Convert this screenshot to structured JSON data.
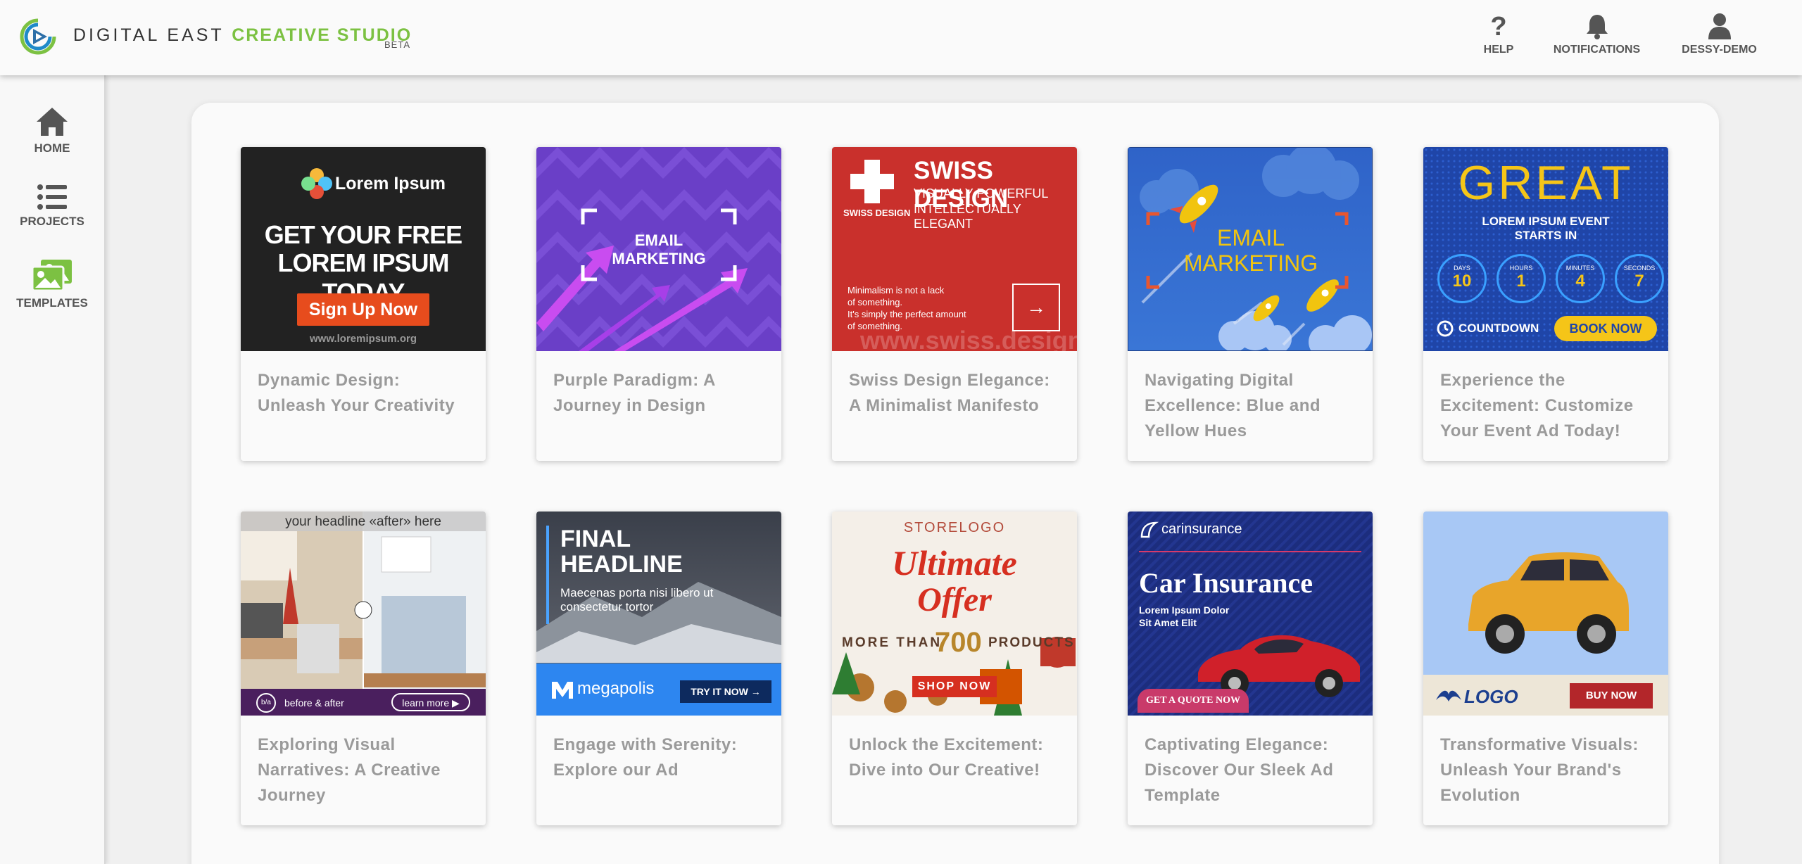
{
  "header": {
    "brand_part1": "DIGITAL EAST",
    "brand_part2": "CREATIVE STUDIO",
    "beta": "BETA",
    "help_label": "HELP",
    "notifications_label": "NOTIFICATIONS",
    "user_label": "DESSY-DEMO"
  },
  "sidebar": {
    "items": [
      {
        "label": "HOME",
        "icon": "home-icon"
      },
      {
        "label": "PROJECTS",
        "icon": "list-icon"
      },
      {
        "label": "TEMPLATES",
        "icon": "images-icon"
      }
    ]
  },
  "colors": {
    "brand_green": "#7cc142",
    "text_gray": "#9a9a9a"
  },
  "templates": [
    {
      "title": "Dynamic Design: Unleash Your Creativity",
      "thumb": {
        "brand": "Lorem Ipsum",
        "headline1": "GET YOUR FREE",
        "headline2": "LOREM IPSUM TODAY",
        "button": "Sign Up Now",
        "url": "www.loremipsum.org"
      }
    },
    {
      "title": "Purple Paradigm: A Journey in Design",
      "thumb": {
        "line1": "EMAIL",
        "line2": "MARKETING"
      }
    },
    {
      "title": "Swiss Design Elegance: A Minimalist Manifesto",
      "thumb": {
        "logo_caption": "SWISS DESIGN",
        "heading": "SWISS DESIGN",
        "sub1": "VISUALLY POWERFUL",
        "sub2": "INTELLECTUALLY ELEGANT",
        "body1": "Minimalism is not a lack",
        "body2": "of something.",
        "body3": "It's simply the perfect amount",
        "body4": "of something.",
        "watermark": "www.swiss.design"
      }
    },
    {
      "title": "Navigating Digital Excellence: Blue and Yellow Hues",
      "thumb": {
        "line1": "EMAIL",
        "line2": "MARKETING"
      }
    },
    {
      "title": "Experience the Excitement: Customize Your Event Ad Today!",
      "thumb": {
        "big": "GREAT",
        "sub1": "LOREM IPSUM EVENT",
        "sub2": "STARTS IN",
        "units": [
          {
            "label": "DAYS",
            "value": "10"
          },
          {
            "label": "HOURS",
            "value": "1"
          },
          {
            "label": "MINUTES",
            "value": "4"
          },
          {
            "label": "SECONDS",
            "value": "7"
          }
        ],
        "countdown": "COUNTDOWN",
        "button": "BOOK NOW"
      }
    },
    {
      "title": "Exploring Visual Narratives: A Creative Journey",
      "thumb": {
        "headline": "your headline «after» here",
        "caption": "before & after",
        "button": "learn more ▶"
      }
    },
    {
      "title": "Engage with Serenity: Explore our Ad",
      "thumb": {
        "h1": "FINAL",
        "h2": "HEADLINE",
        "body1": "Maecenas porta nisi libero ut",
        "body2": "consectetur tortor",
        "brand": "megapolis",
        "button": "TRY IT NOW →"
      }
    },
    {
      "title": "Unlock the Excitement: Dive into Our Creative!",
      "thumb": {
        "store": "STORELOGO",
        "h1": "Ultimate",
        "h2": "Offer",
        "more": "MORE THAN",
        "num": "700",
        "products": "PRODUCTS",
        "button": "SHOP NOW"
      }
    },
    {
      "title": "Captivating Elegance: Discover Our Sleek Ad Template",
      "thumb": {
        "brand": "carinsurance",
        "heading": "Car Insurance",
        "sub1": "Lorem Ipsum Dolor",
        "sub2": "Sit Amet Elit",
        "button": "GET A QUOTE NOW"
      }
    },
    {
      "title": "Transformative Visuals: Unleash Your Brand's Evolution",
      "thumb": {
        "logo": "LOGO",
        "button": "BUY NOW"
      }
    }
  ]
}
